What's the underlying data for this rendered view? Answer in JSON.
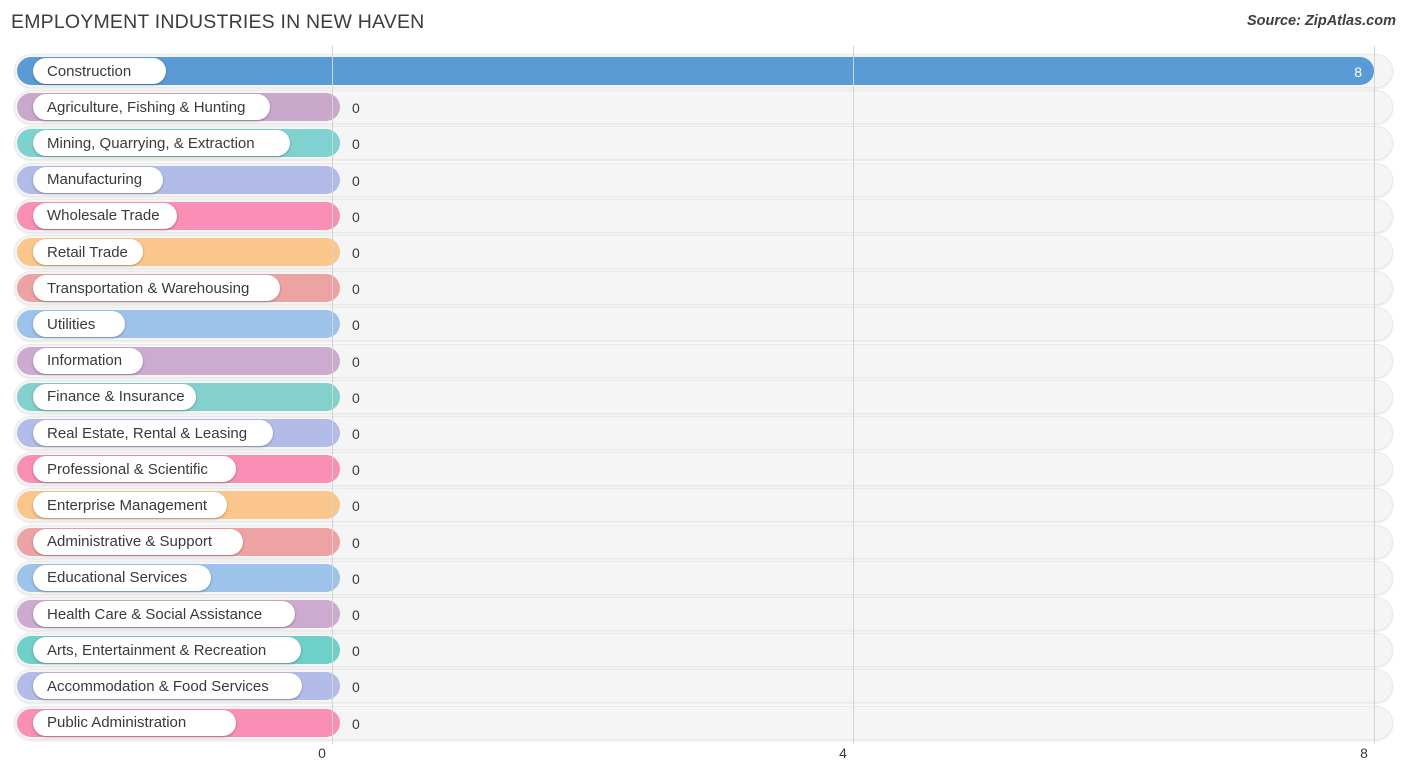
{
  "header": {
    "title": "EMPLOYMENT INDUSTRIES IN NEW HAVEN",
    "source": "Source: ZipAtlas.com"
  },
  "chart_data": {
    "type": "bar",
    "orientation": "horizontal",
    "title": "EMPLOYMENT INDUSTRIES IN NEW HAVEN",
    "xlabel": "",
    "ylabel": "",
    "xlim": [
      0,
      8
    ],
    "ticks": [
      "0",
      "4",
      "8"
    ],
    "tick_values": [
      0,
      4,
      8
    ],
    "grid": true,
    "legend": "none",
    "categories": [
      "Construction",
      "Agriculture, Fishing & Hunting",
      "Mining, Quarrying, & Extraction",
      "Manufacturing",
      "Wholesale Trade",
      "Retail Trade",
      "Transportation & Warehousing",
      "Utilities",
      "Information",
      "Finance & Insurance",
      "Real Estate, Rental & Leasing",
      "Professional & Scientific",
      "Enterprise Management",
      "Administrative & Support",
      "Educational Services",
      "Health Care & Social Assistance",
      "Arts, Entertainment & Recreation",
      "Accommodation & Food Services",
      "Public Administration"
    ],
    "values": [
      8,
      0,
      0,
      0,
      0,
      0,
      0,
      0,
      0,
      0,
      0,
      0,
      0,
      0,
      0,
      0,
      0,
      0,
      0
    ],
    "value_labels": [
      "8",
      "0",
      "0",
      "0",
      "0",
      "0",
      "0",
      "0",
      "0",
      "0",
      "0",
      "0",
      "0",
      "0",
      "0",
      "0",
      "0",
      "0",
      "0"
    ],
    "colors": [
      "#5b9bd5",
      "#c9a8cc",
      "#7fd2d0",
      "#b3bce8",
      "#f98fb4",
      "#fbc68b",
      "#eda3a3",
      "#9dc3ea",
      "#cdaacf",
      "#84d0cd",
      "#b3bce8",
      "#f98fb4",
      "#fbc68b",
      "#eda3a3",
      "#9dc3ea",
      "#cdaacf",
      "#6fcfc9",
      "#b3bce8",
      "#f98fb4"
    ],
    "pill_widths": [
      133,
      237,
      257,
      130,
      144,
      110,
      247,
      92,
      110,
      163,
      240,
      203,
      194,
      210,
      178,
      262,
      268,
      269,
      203
    ]
  }
}
